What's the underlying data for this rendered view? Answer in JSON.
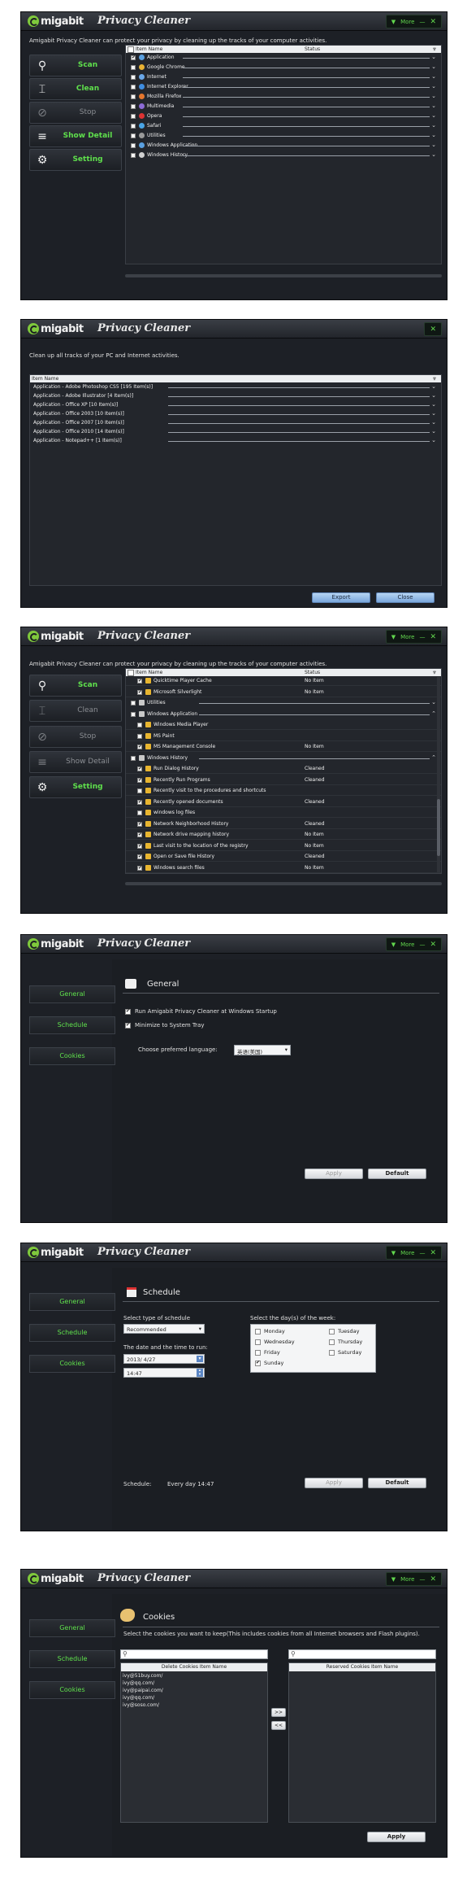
{
  "common": {
    "logo_text": "migabit",
    "app_title": "Privacy Cleaner",
    "more": "More",
    "minimize": "—",
    "close": "✕"
  },
  "win1": {
    "description": "Amigabit Privacy Cleaner can protect your privacy by cleaning up the tracks of your computer activities.",
    "buttons": [
      "Scan",
      "Clean",
      "Stop",
      "Show Detail",
      "Setting"
    ],
    "col_name": "Item Name",
    "col_status": "Status",
    "items": [
      "Application",
      "Google Chrome",
      "Internet",
      "Internet Explorer",
      "Mozilla Firefox",
      "Multimedia",
      "Opera",
      "Safari",
      "Utilities",
      "Windows Application",
      "Windows History"
    ]
  },
  "win2": {
    "description": "Clean up all tracks of your PC and Internet activities.",
    "col_name": "Item Name",
    "items": [
      "Application - Adobe Photoshop CS5 [195 Item(s)]",
      "Application - Adobe Illustrator [4 Item(s)]",
      "Application - Office XP [10 Item(s)]",
      "Application - Office 2003 [10 Item(s)]",
      "Application - Office 2007 [10 Item(s)]",
      "Application - Office 2010 [14 Item(s)]",
      "Application - Notepad++ [1 Item(s)]"
    ],
    "export": "Export",
    "close": "Close"
  },
  "win3": {
    "description": "Amigabit Privacy Cleaner can protect your privacy by cleaning up the tracks of your computer activities.",
    "buttons": [
      "Scan",
      "Clean",
      "Stop",
      "Show Detail",
      "Setting"
    ],
    "col_name": "Item Name",
    "col_status": "Status",
    "rows": [
      {
        "name": "Quicktime Player Cache",
        "status": "No Item"
      },
      {
        "name": "Microsoft Silverlight",
        "status": "No Item"
      },
      {
        "name": "Utilities",
        "status": ""
      },
      {
        "name": "Windows Application",
        "status": ""
      },
      {
        "name": "Windows Media Player",
        "status": ""
      },
      {
        "name": "MS Paint",
        "status": ""
      },
      {
        "name": "MS Management Console",
        "status": "No Item"
      },
      {
        "name": "Windows History",
        "status": ""
      },
      {
        "name": "Run Dialog History",
        "status": "Cleaned"
      },
      {
        "name": "Recently Run Programs",
        "status": "Cleaned"
      },
      {
        "name": "Recently visit to the procedures and shortcuts",
        "status": ""
      },
      {
        "name": "Recently opened documents",
        "status": "Cleaned"
      },
      {
        "name": "windows log files",
        "status": ""
      },
      {
        "name": "Network Neighborhood History",
        "status": "Cleaned"
      },
      {
        "name": "Network drive mapping history",
        "status": "No Item"
      },
      {
        "name": "Last visit to the location of the registry",
        "status": "No Item"
      },
      {
        "name": "Open or Save file History",
        "status": "Cleaned"
      },
      {
        "name": "Windows search files",
        "status": "No Item"
      }
    ]
  },
  "win4": {
    "nav": [
      "General",
      "Schedule",
      "Cookies"
    ],
    "title": "General",
    "opt1": "Run Amigabit Privacy Cleaner at Windows Startup",
    "opt2": "Minimize to System Tray",
    "lang_label": "Choose preferred language:",
    "lang_value": "英语(美国)",
    "apply": "Apply",
    "default": "Default"
  },
  "win5": {
    "nav": [
      "General",
      "Schedule",
      "Cookies"
    ],
    "title": "Schedule",
    "type_label": "Select type of schedule",
    "type_value": "Recommended",
    "date_label": "The date and the time to run:",
    "date_value": "2013/ 4/27",
    "time_value": "14:47",
    "days_label": "Select the day(s) of the week:",
    "days": [
      "Monday",
      "Tuesday",
      "Wednesday",
      "Thursday",
      "Friday",
      "Saturday",
      "Sunday"
    ],
    "days_checked": [
      false,
      false,
      false,
      false,
      false,
      false,
      true
    ],
    "schedule_label": "Schedule:",
    "schedule_value": "Every day 14:47",
    "apply": "Apply",
    "default": "Default"
  },
  "win6": {
    "nav": [
      "General",
      "Schedule",
      "Cookies"
    ],
    "title": "Cookies",
    "instruction": "Select the cookies you want to keep(This includes cookies from all Internet browsers and Flash plugins).",
    "delete_header": "Delete Cookies Item Name",
    "reserve_header": "Reserved Cookies Item Name",
    "cookies": [
      "ivy@51buy.com/",
      "ivy@qq.com/",
      "ivy@paipai.com/",
      "ivy@qq.com/",
      "ivy@soso.com/"
    ],
    "move_right": ">>",
    "move_left": "<<",
    "apply": "Apply"
  }
}
